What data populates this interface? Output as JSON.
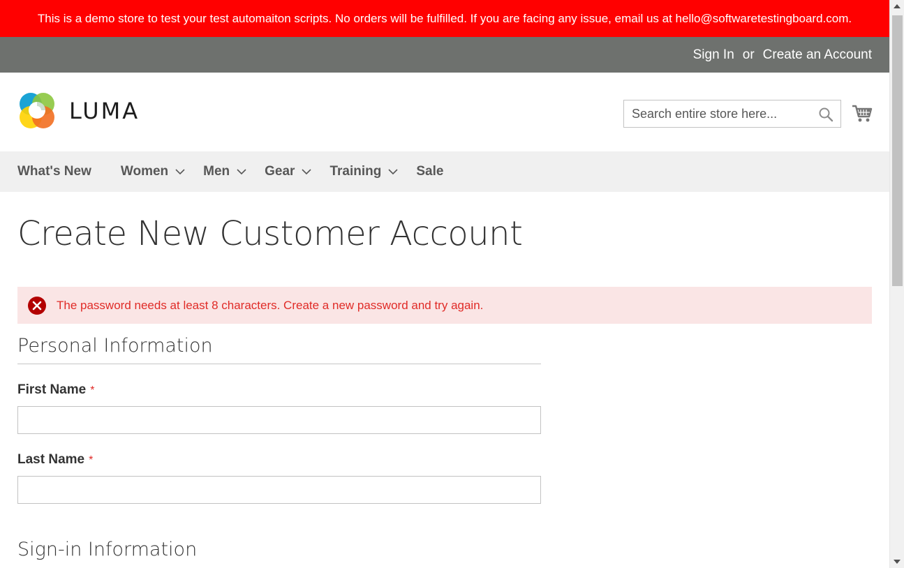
{
  "demo_banner": {
    "text": "This is a demo store to test your test automaiton scripts. No orders will be fulfilled. If you are facing any issue, email us at hello@softwaretestingboard.com.",
    "background": "#ff0000"
  },
  "panel_header": {
    "sign_in": "Sign In",
    "or": "or",
    "create_account": "Create an Account",
    "background": "#6e716e"
  },
  "header": {
    "logo_text": "LUMA",
    "search_placeholder": "Search entire store here...",
    "search_icon": "search-icon",
    "cart_icon": "cart-icon"
  },
  "nav": {
    "items": [
      {
        "label": "What's New",
        "has_submenu": false
      },
      {
        "label": "Women",
        "has_submenu": true
      },
      {
        "label": "Men",
        "has_submenu": true
      },
      {
        "label": "Gear",
        "has_submenu": true
      },
      {
        "label": "Training",
        "has_submenu": true
      },
      {
        "label": "Sale",
        "has_submenu": false
      }
    ]
  },
  "main": {
    "page_title": "Create New Customer Account",
    "error_message": "The password needs at least 8 characters. Create a new password and try again.",
    "personal_info_title": "Personal Information",
    "first_name_label": "First Name",
    "last_name_label": "Last Name",
    "required_mark": "*",
    "first_name_value": "",
    "last_name_value": "",
    "signin_info_title": "Sign-in Information"
  },
  "colors": {
    "error_text": "#e02b27",
    "error_bg": "#fae5e5",
    "nav_bg": "#f0f0f0"
  }
}
